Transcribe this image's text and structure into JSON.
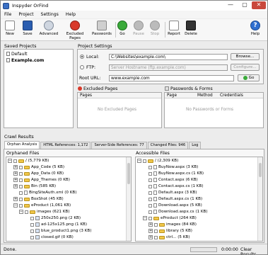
{
  "window": {
    "title": "Inspyder OrFind",
    "close_glyph": "✕",
    "min_glyph": "—",
    "max_glyph": "▢"
  },
  "menu": [
    "File",
    "Project",
    "Settings",
    "Help"
  ],
  "toolbar": {
    "new": "New",
    "save": "Save",
    "advanced": "Advanced",
    "excluded_pages": "Excluded Pages",
    "passwords": "Passwords",
    "go": "Go",
    "pause": "Pause",
    "stop": "Stop",
    "report": "Report",
    "delete": "Delete",
    "help": "Help",
    "help_glyph": "?"
  },
  "saved_projects": {
    "label": "Saved Projects",
    "items": [
      {
        "name": "Default"
      },
      {
        "name": "Example.com"
      }
    ]
  },
  "project_settings": {
    "label": "Project Settings",
    "local_label": "Local:",
    "local_value": "C:\\Websites\\example.com\\",
    "browse_label": "Browse...",
    "ftp_label": "FTP:",
    "ftp_placeholder": "Server Hostname (ftp.example.com)",
    "configure_label": "Configure...",
    "root_url_label": "Root URL:",
    "root_url_value": "www.example.com",
    "go_label": "Go"
  },
  "excluded_pages": {
    "label": "Excluded Pages",
    "column": "Pages",
    "empty": "No Excluded Pages"
  },
  "passwords_forms": {
    "label": "Passwords & Forms",
    "columns": [
      "Page",
      "Method",
      "Credentials"
    ],
    "empty": "No Passwords or Forms"
  },
  "crawl_results": {
    "label": "Crawl Results",
    "tabs": [
      "Orphan Analysis",
      "HTML References: 1,172",
      "Server-Side References: 77",
      "Changed Files: 946",
      "Log"
    ],
    "orphaned_label": "Orphaned Files",
    "accessible_label": "Accessible Files",
    "orphaned": [
      "/ (5,779 KB)",
      "App_Code (5 KB)",
      "App_Data (0 KB)",
      "App_Themes (0 KB)",
      "Bin (585 KB)",
      "BingSiteAuth.xml (0 KB)",
      "BoxShot (45 KB)",
      "eProduct (1,061 KB)",
      "images (621 KB)",
      "250x250.png (2 KB)",
      "ad-125x125.png (1 KB)",
      "blue_product1.png (3 KB)",
      "closed.gif (0 KB)"
    ],
    "accessible": [
      "/ (2,309 KB)",
      "BuyNow.aspx (3 KB)",
      "BuyNow.aspx.cs (1 KB)",
      "Contact.aspx (6 KB)",
      "Contact.aspx.cs (1 KB)",
      "Default.aspx (3 KB)",
      "Default.aspx.cs (1 KB)",
      "Download.aspx (5 KB)",
      "Download.aspx.cs (1 KB)",
      "eProduct (264 KB)",
      "images (84 KB)",
      "library (5 KB)",
      "ctrl... (5 KB)"
    ]
  },
  "status": {
    "text": "Done.",
    "elapsed": "0:00:00",
    "clear_label": "Clear Results",
    "progress": 0.0
  }
}
